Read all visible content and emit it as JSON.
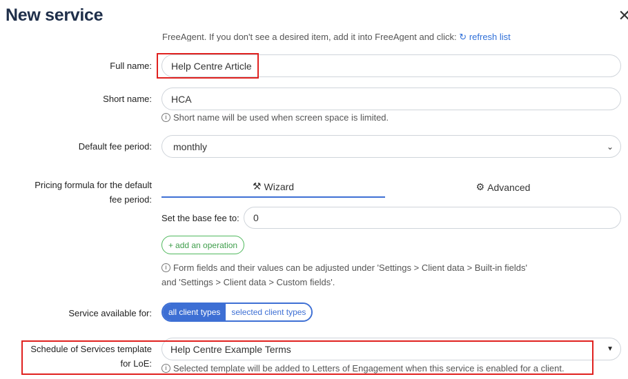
{
  "dialog": {
    "title": "New service",
    "close_glyph": "✕"
  },
  "notice": {
    "text": "FreeAgent. If you don't see a desired item, add it into FreeAgent and click:",
    "refresh_icon": "↻",
    "refresh_label": "refresh list"
  },
  "fields": {
    "full_name": {
      "label": "Full name:",
      "value": "Help Centre Article"
    },
    "short_name": {
      "label": "Short name:",
      "value": "HCA",
      "hint": "Short name will be used when screen space is limited."
    },
    "fee_period": {
      "label": "Default fee period:",
      "value": "monthly"
    },
    "pricing": {
      "label_line1": "Pricing formula for the default",
      "label_line2": "fee period:",
      "tabs": [
        {
          "icon": "magic-wand-icon",
          "glyph": "⚒",
          "label": "Wizard",
          "active": true
        },
        {
          "icon": "gears-icon",
          "glyph": "⚙",
          "label": "Advanced",
          "active": false
        }
      ],
      "base_fee_label": "Set the base fee to:",
      "base_fee_value": "0",
      "add_operation": "add an operation",
      "note_line1": "Form fields and their values can be adjusted under 'Settings > Client data > Built-in fields'",
      "note_line2": "and 'Settings > Client data > Custom fields'."
    },
    "availability": {
      "label": "Service available for:",
      "options": [
        "all client types",
        "selected client types"
      ],
      "selected": "all client types"
    },
    "schedule": {
      "label_line1": "Schedule of Services template",
      "label_line2": "for LoE:",
      "value": "Help Centre Example Terms",
      "hint": "Selected template will be added to Letters of Engagement when this service is enabled for a client."
    }
  },
  "colors": {
    "accent": "#3d6fd4",
    "success": "#4fb85c",
    "highlight": "#e0201e",
    "title": "#1f2f4a"
  }
}
